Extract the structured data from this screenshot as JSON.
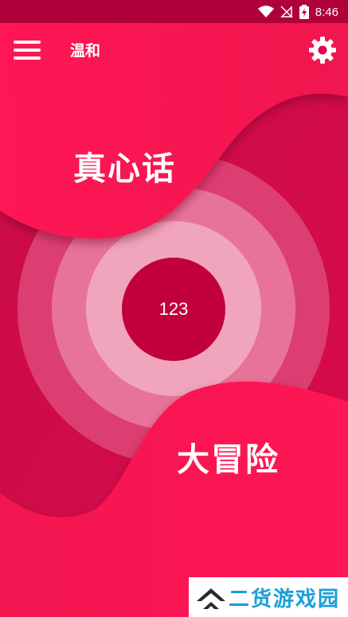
{
  "status_bar": {
    "time": "8:46",
    "icons": [
      "wifi-icon",
      "signal-off-icon",
      "battery-charging-icon"
    ]
  },
  "app_bar": {
    "title": "温和",
    "menu_icon": "menu-icon",
    "settings_icon": "gear-icon"
  },
  "game": {
    "truth_label": "真心话",
    "dare_label": "大冒险",
    "counter_value": "123"
  },
  "watermark": {
    "text": "二货游戏园"
  },
  "colors": {
    "background": "#c20a44",
    "wave": "#ff1654",
    "ring_outer": "#dc3e72",
    "ring_middle": "#e8739a",
    "ring_inner": "#f0a5bd",
    "center": "#c2003d"
  }
}
